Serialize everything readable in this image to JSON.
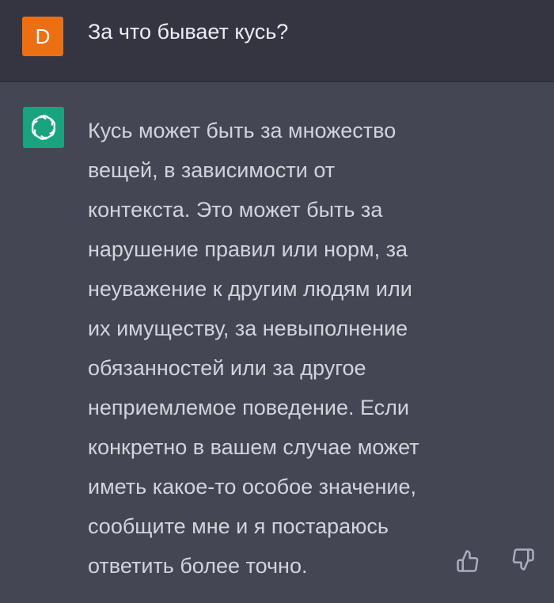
{
  "user_message": {
    "avatar_letter": "D",
    "avatar_color": "#ec7013",
    "text": "За что бывает кусь?"
  },
  "assistant_message": {
    "avatar_icon": "openai-logo-icon",
    "avatar_color": "#19a37f",
    "lines": [
      "Кусь может быть за множество",
      "вещей, в зависимости от",
      "контекста. Это может быть за",
      "нарушение правил или норм, за",
      "неуважение к другим людям или",
      "их имуществу, за невыполнение",
      "обязанностей или за другое",
      "неприемлемое поведение. Если",
      "конкретно в вашем случае может",
      "иметь какое-то особое значение,",
      "сообщите мне и я постараюсь",
      "ответить более точно."
    ],
    "feedback": {
      "up_icon": "thumbs-up-icon",
      "down_icon": "thumbs-down-icon"
    }
  },
  "colors": {
    "user_row_bg": "#343541",
    "assistant_row_bg": "#444654",
    "text": "#d1d5db"
  }
}
